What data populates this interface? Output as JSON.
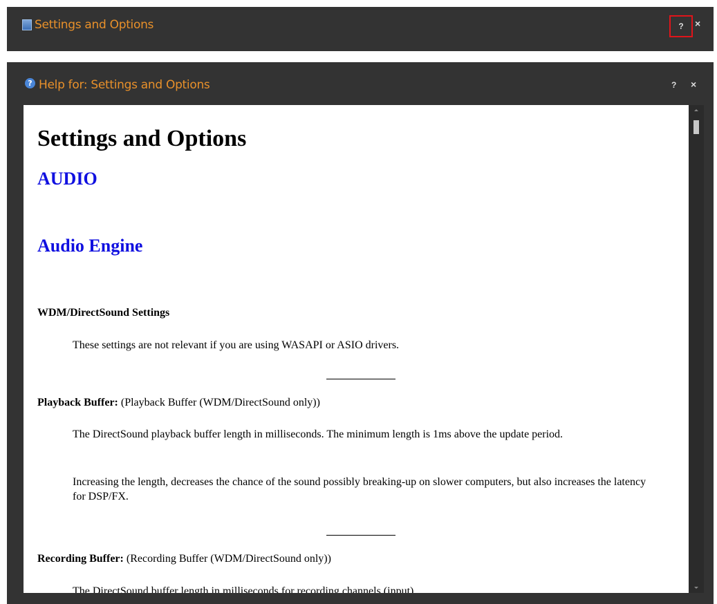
{
  "settings_window": {
    "title": "Settings and Options",
    "help_label": "?",
    "close_label": "×"
  },
  "help_window": {
    "title": "Help for: Settings and Options",
    "help_label": "?",
    "close_label": "×",
    "icon_label": "?"
  },
  "doc": {
    "heading": "Settings and Options",
    "section1": "AUDIO",
    "section2": "Audio Engine",
    "subheading": "WDM/DirectSound Settings",
    "intro": "These settings are not relevant if you are using WASAPI or ASIO drivers.",
    "playback_term": "Playback Buffer:",
    "playback_desc": " (Playback Buffer (WDM/DirectSound only))",
    "playback_p1": "The DirectSound playback buffer length in milliseconds. The minimum length is 1ms above the update period.",
    "playback_p2": "Increasing the length, decreases the chance of the sound possibly breaking-up on slower computers, but also increases the latency for DSP/FX.",
    "recording_term": "Recording Buffer:",
    "recording_desc": " (Recording Buffer (WDM/DirectSound only))",
    "recording_p1": "The DirectSound buffer length in milliseconds for recording channels (input)."
  },
  "colors": {
    "title_orange": "#e8902a",
    "link_blue": "#1010e0",
    "highlight_red": "#e0141a",
    "chrome_dark": "#333333"
  },
  "icons": [
    "app-icon",
    "help-circle-icon",
    "close-icon"
  ]
}
